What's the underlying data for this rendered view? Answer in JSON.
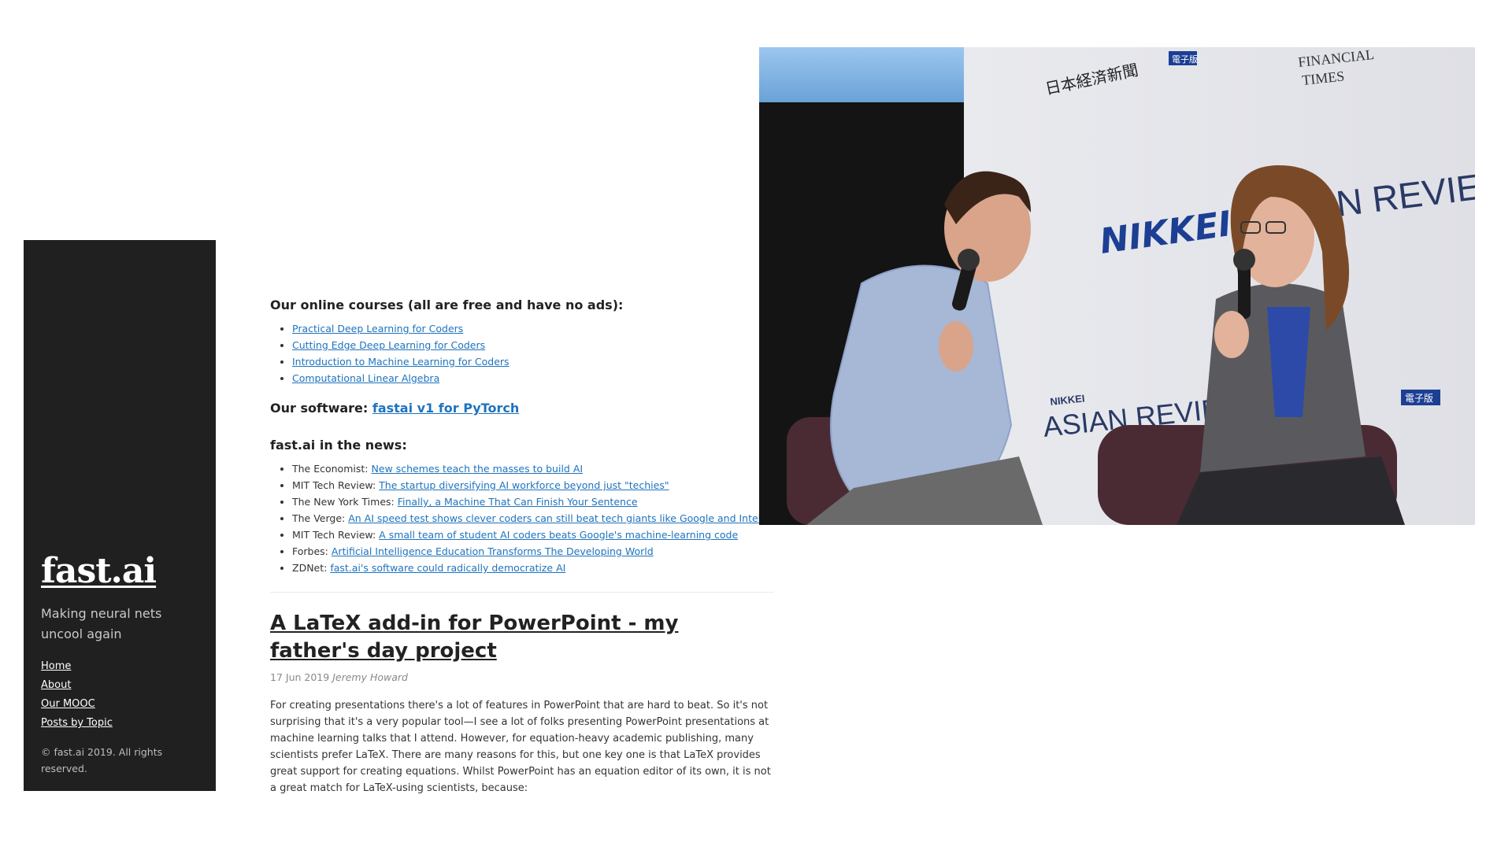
{
  "sidebar": {
    "brand": "fast.ai",
    "tagline": "Making neural nets uncool again",
    "nav": [
      "Home",
      "About",
      "Our MOOC",
      "Posts by Topic"
    ],
    "copyright": "© fast.ai 2019. All rights reserved."
  },
  "courses": {
    "heading": "Our online courses (all are free and have no ads):",
    "items": [
      "Practical Deep Learning for Coders",
      "Cutting Edge Deep Learning for Coders",
      "Introduction to Machine Learning for Coders",
      "Computational Linear Algebra"
    ]
  },
  "software": {
    "label": "Our software:",
    "link": "fastai v1 for PyTorch"
  },
  "news": {
    "heading": "fast.ai in the news:",
    "items": [
      {
        "source": "The Economist:",
        "title": "New schemes teach the masses to build AI"
      },
      {
        "source": "MIT Tech Review:",
        "title": "The startup diversifying AI workforce beyond just \"techies\""
      },
      {
        "source": "The New York Times:",
        "title": "Finally, a Machine That Can Finish Your Sentence"
      },
      {
        "source": "The Verge:",
        "title": "An AI speed test shows clever coders can still beat tech giants like Google and Intel"
      },
      {
        "source": "MIT Tech Review:",
        "title": "A small team of student AI coders beats Google's machine-learning code"
      },
      {
        "source": "Forbes:",
        "title": "Artificial Intelligence Education Transforms The Developing World"
      },
      {
        "source": "ZDNet:",
        "title": "fast.ai's software could radically democratize AI"
      }
    ]
  },
  "post": {
    "title": "A LaTeX add-in for PowerPoint - my father's day project",
    "date": "17 Jun 2019",
    "author": "Jeremy Howard",
    "body": "For creating presentations there's a lot of features in PowerPoint that are hard to beat. So it's not surprising that it's a very popular tool—I see a lot of folks presenting PowerPoint presentations at machine learning talks that I attend. However, for equation-heavy academic publishing, many scientists prefer LaTeX. There are many reasons for this, but one key one is that LaTeX provides great support for creating equations. Whilst PowerPoint has an equation editor of its own, it is not a great match for LaTeX-using scientists, because:"
  },
  "photo": {
    "backdrop_text": [
      "日本経済新聞",
      "電子版",
      "FINANCIAL",
      "TIMES",
      "NIKKEI",
      "N REVIEW",
      "NIKKEI",
      "ASIAN REVIEW",
      "電子版"
    ]
  },
  "colors": {
    "sidebar_bg": "#202020",
    "link": "#1e73be",
    "nikkei_blue": "#1c3f94"
  }
}
